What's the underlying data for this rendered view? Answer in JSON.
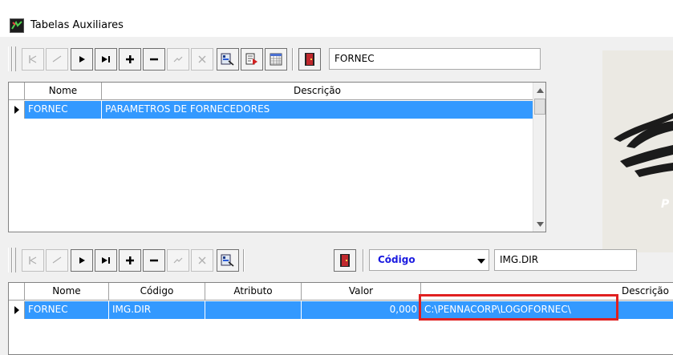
{
  "window": {
    "title": "Tabelas Auxiliares",
    "icon": "app-icon"
  },
  "top_section": {
    "search_value": "FORNEC",
    "grid": {
      "columns": [
        "Nome",
        "Descrição"
      ],
      "rows": [
        {
          "nome": "FORNEC",
          "descricao": "PARAMETROS DE FORNECEDORES"
        }
      ]
    }
  },
  "bottom_section": {
    "combo_selected": "Código",
    "search_value": "IMG.DIR",
    "grid": {
      "columns": [
        "Nome",
        "Código",
        "Atributo",
        "Valor",
        "Descrição"
      ],
      "rows": [
        {
          "nome": "FORNEC",
          "codigo": "IMG.DIR",
          "atributo": "",
          "valor": "0,000",
          "descricao": "C:\\PENNACORP\\LOGOFORNEC\\"
        }
      ]
    }
  },
  "logo_text": "P",
  "colors": {
    "selection": "#3399ff",
    "highlight": "#e02020",
    "combo_text": "#1a1ae0",
    "exit_door": "#c0282d"
  }
}
